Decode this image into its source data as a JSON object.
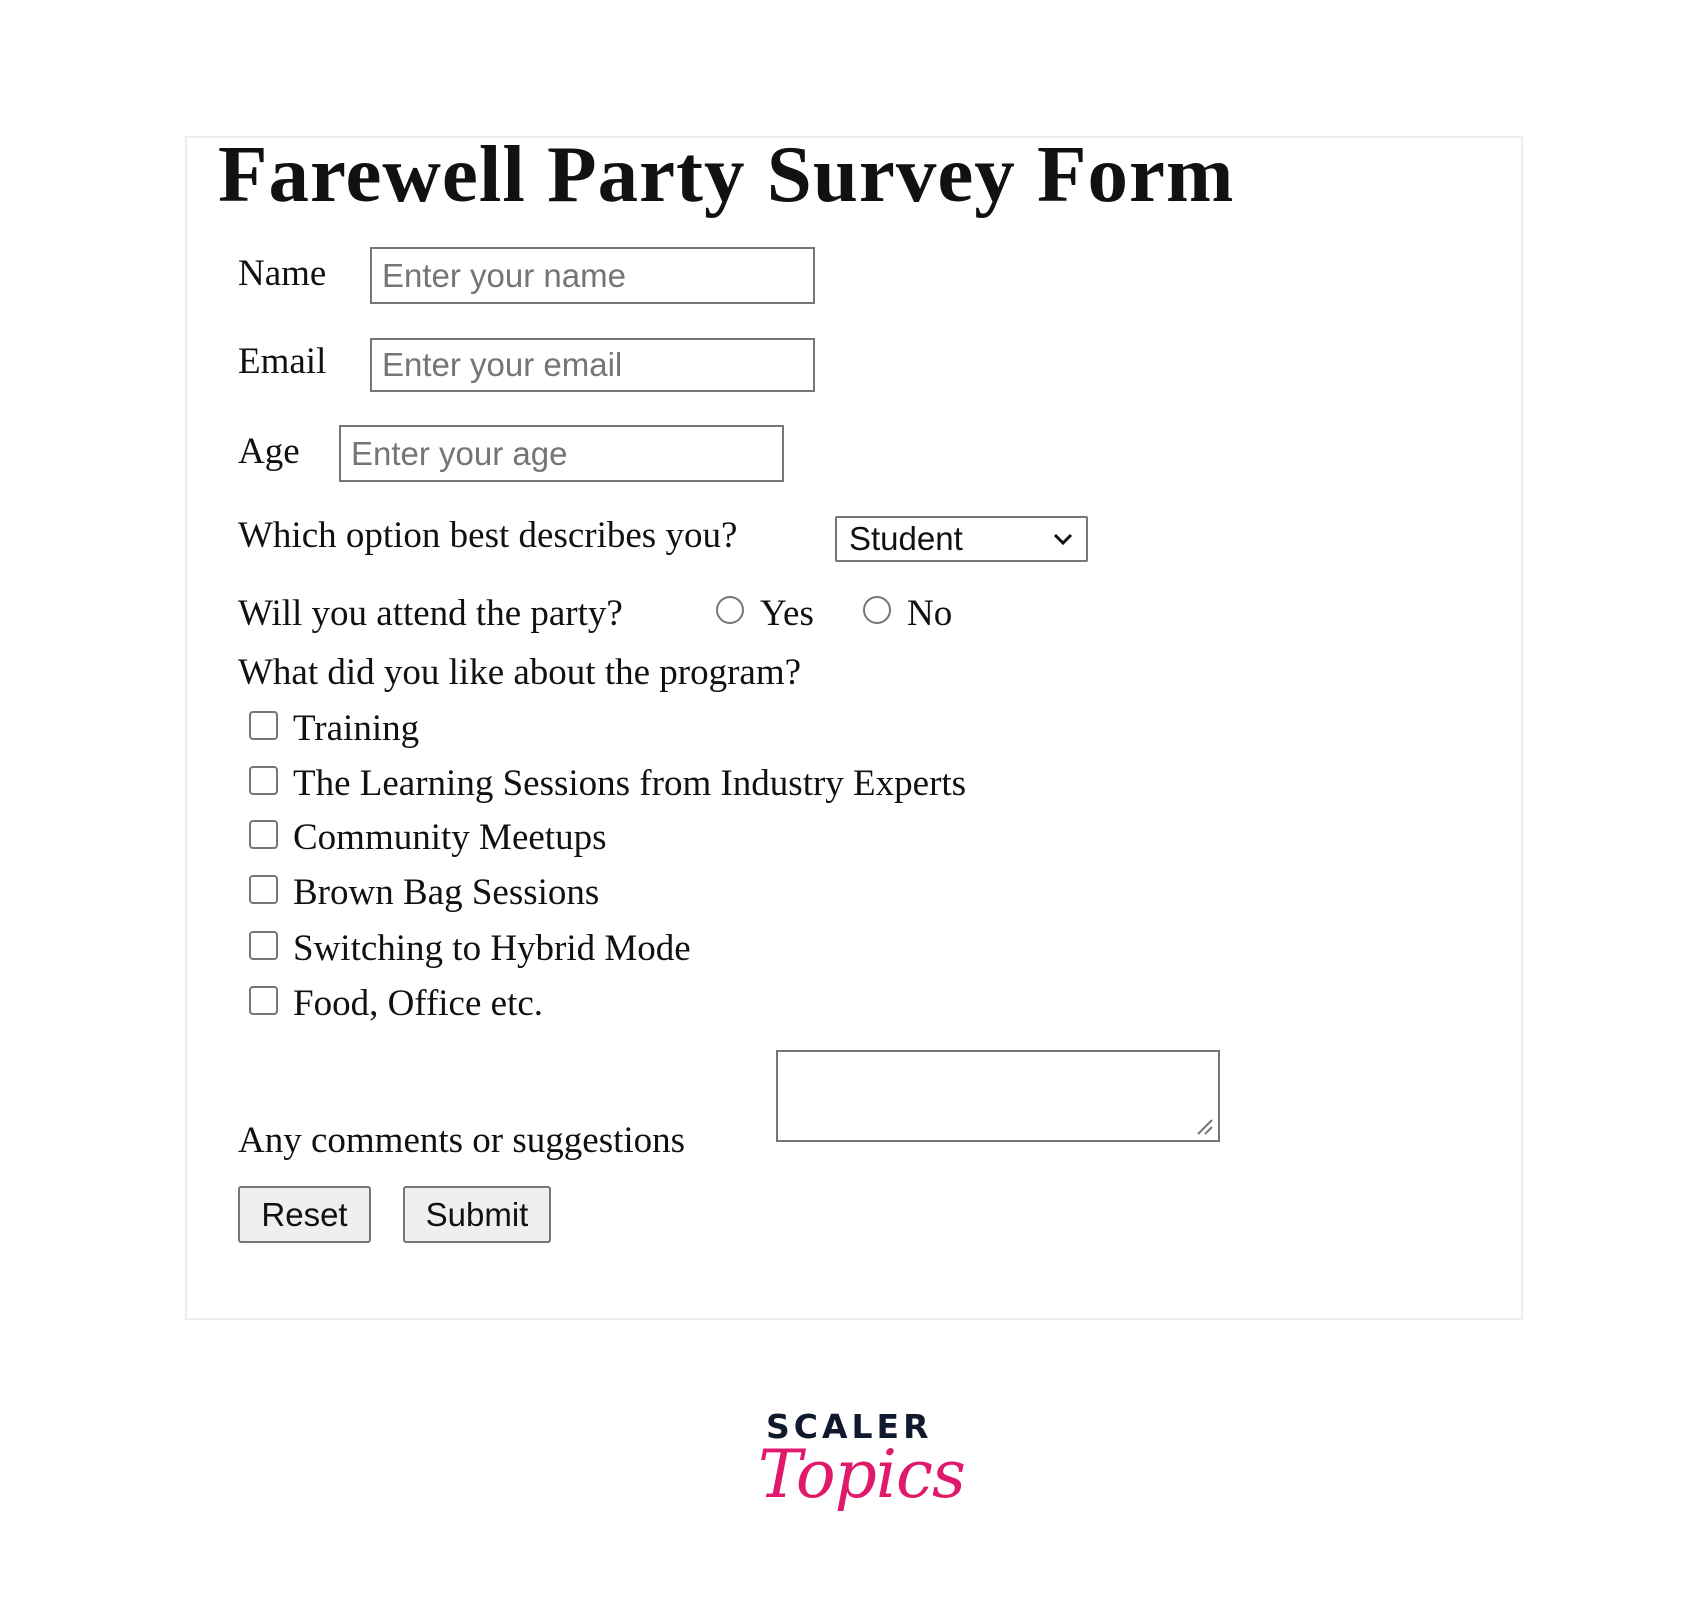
{
  "form": {
    "title": "Farewell Party Survey Form",
    "name": {
      "label": "Name",
      "placeholder": "Enter your name"
    },
    "email": {
      "label": "Email",
      "placeholder": "Enter your email"
    },
    "age": {
      "label": "Age",
      "placeholder": "Enter your age"
    },
    "role": {
      "label": "Which option best describes you?",
      "selected": "Student"
    },
    "attend": {
      "label": "Will you attend the party?",
      "options": [
        "Yes",
        "No"
      ]
    },
    "likes": {
      "label": "What did you like about the program?",
      "options": [
        "Training",
        "The Learning Sessions from Industry Experts",
        "Community Meetups",
        "Brown Bag Sessions",
        "Switching to Hybrid Mode",
        "Food, Office etc."
      ]
    },
    "comments": {
      "label": "Any comments or suggestions"
    },
    "reset_label": "Reset",
    "submit_label": "Submit"
  },
  "logo": {
    "top": "SCALER",
    "script": "Topics",
    "brand_color": "#e0196b"
  }
}
